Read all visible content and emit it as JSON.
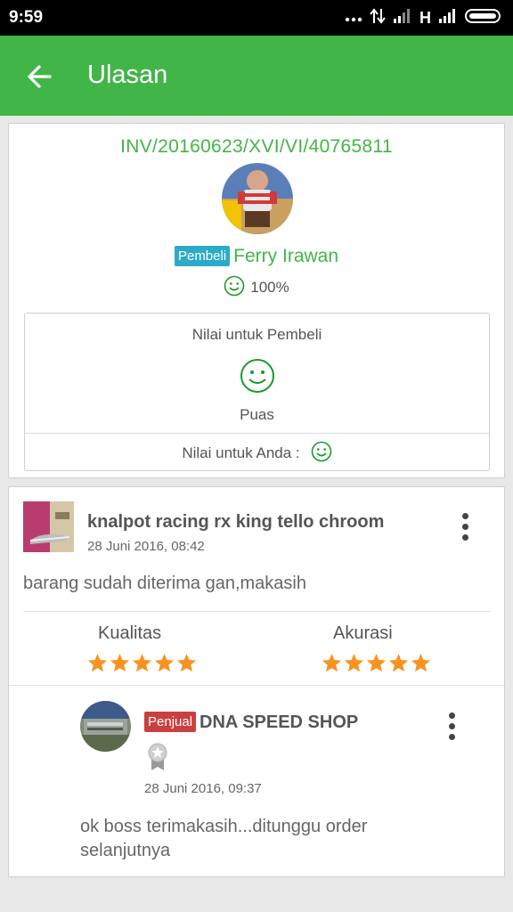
{
  "status_bar": {
    "time": "9:59",
    "network": "H"
  },
  "app_bar": {
    "title": "Ulasan"
  },
  "transaction": {
    "invoice": "INV/20160623/XVI/VI/40765811",
    "buyer_badge": "Pembeli",
    "buyer_name": "Ferry Irawan",
    "reputation": "100%",
    "rating_title": "Nilai untuk Pembeli",
    "rating_result": "Puas",
    "rating_for_you": "Nilai untuk Anda :"
  },
  "review": {
    "product_name": "knalpot racing rx king tello chroom",
    "date": "28 Juni 2016, 08:42",
    "text": "barang sudah diterima gan,makasih",
    "quality_label": "Kualitas",
    "quality_stars": 5,
    "accuracy_label": "Akurasi",
    "accuracy_stars": 5
  },
  "reply": {
    "seller_badge": "Penjual",
    "seller_name": "DNA SPEED SHOP",
    "date": "28 Juni 2016, 09:37",
    "text": "ok boss terimakasih...ditunggu order selanjutnya"
  },
  "colors": {
    "brand_green": "#42b549",
    "buyer_badge": "#2dabc6",
    "seller_badge": "#c9403f",
    "star": "#f7931e"
  }
}
